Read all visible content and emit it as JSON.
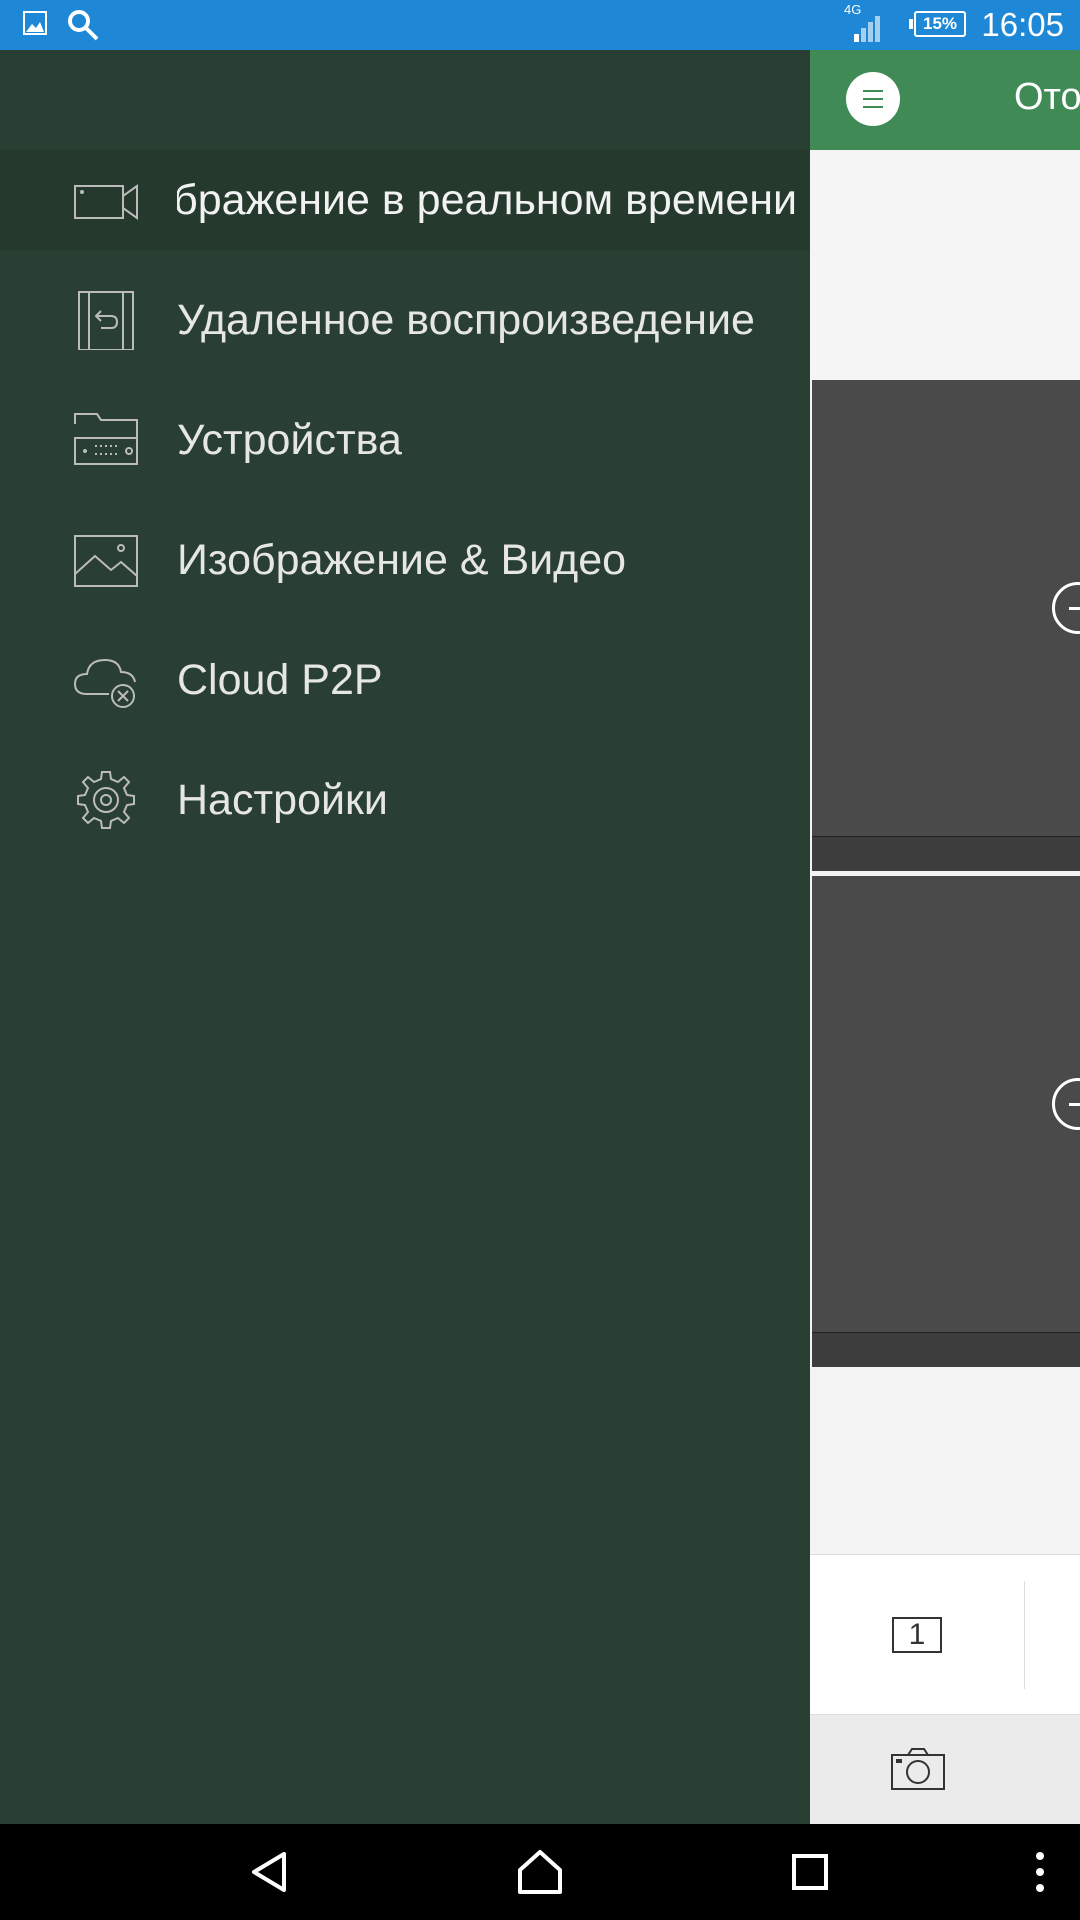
{
  "status_bar": {
    "network": "4G",
    "battery": "15%",
    "time": "16:05",
    "icons": [
      "gallery-icon",
      "search-icon",
      "signal-icon",
      "battery-icon"
    ]
  },
  "drawer": {
    "items": [
      {
        "label": "Отображение в реальном времени",
        "icon": "camera-icon",
        "active": true
      },
      {
        "label": "Удаленное воспроизведение",
        "icon": "playback-icon",
        "active": false
      },
      {
        "label": "Устройства",
        "icon": "device-icon",
        "active": false
      },
      {
        "label": "Изображение & Видео",
        "icon": "image-icon",
        "active": false
      },
      {
        "label": "Cloud P2P",
        "icon": "cloud-icon",
        "active": false
      },
      {
        "label": "Настройки",
        "icon": "gear-icon",
        "active": false
      }
    ]
  },
  "app": {
    "title": "Отображение в реальном времени",
    "layout_label": "1",
    "colors": {
      "toolbar": "#3f8a55",
      "drawer": "#2a3f33",
      "statusbar": "#1e88d6"
    }
  },
  "navbar": {
    "icons": [
      "back-icon",
      "home-icon",
      "recents-icon",
      "more-icon"
    ]
  }
}
